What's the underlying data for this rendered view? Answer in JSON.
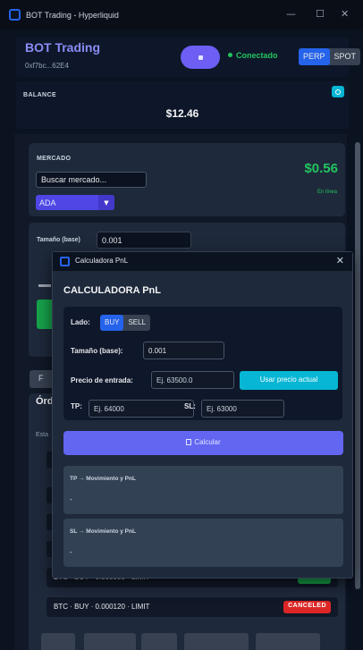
{
  "window": {
    "title": "BOT Trading - Hyperliquid",
    "minimize": "—",
    "maximize": "☐",
    "close": "✕"
  },
  "header": {
    "brand": "BOT Trading",
    "address": "0xf7bc...62E4",
    "status": "Conectado",
    "modes": [
      "PERP",
      "SPOT"
    ],
    "active_mode": "PERP"
  },
  "balance": {
    "label": "BALANCE",
    "value": "$12.46"
  },
  "market": {
    "label": "MERCADO",
    "search_placeholder": "Buscar mercado...",
    "selected": "ADA",
    "price": "$0.56",
    "status": "En línea"
  },
  "order_form": {
    "size_label": "Tamaño (base)",
    "size_value": "0.001",
    "tab_partial": "F"
  },
  "orders": {
    "title_partial": "Órd",
    "state_partial": "Esta",
    "rows": [
      {
        "text": "BTC · BUY · 0.000000 · LIMIT",
        "badge": "FILLED",
        "badge_color": "#16a34a"
      },
      {
        "text": "BTC · BUY · 0.000120 · LIMIT",
        "badge": "CANCELED",
        "badge_color": "#dc2626"
      }
    ]
  },
  "calculator": {
    "window_title": "Calculadora PnL",
    "heading": "CALCULADORA PnL",
    "side_label": "Lado:",
    "sides": [
      "BUY",
      "SELL"
    ],
    "active_side": "BUY",
    "size_label": "Tamaño (base):",
    "size_value": "0.001",
    "entry_label": "Precio de entrada:",
    "entry_placeholder": "Ej. 63500.0",
    "use_price_button": "Usar precio actual",
    "tp_label": "TP:",
    "tp_placeholder": "Ej. 64000",
    "sl_label": "SL:",
    "sl_placeholder": "Ej. 63000",
    "calculate_button": "Calcular",
    "tp_result_label": "TP → Movimiento y PnL",
    "tp_result_value": "-",
    "sl_result_label": "SL → Movimiento y PnL",
    "sl_result_value": "-"
  },
  "colors": {
    "accent": "#6366f1",
    "positive": "#22c55e",
    "cyan": "#06b6d4",
    "primary_blue": "#2563eb"
  }
}
